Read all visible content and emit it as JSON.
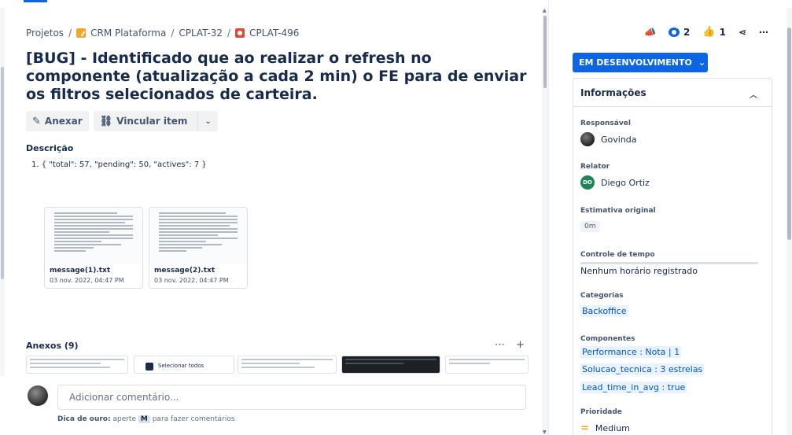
{
  "breadcrumb": {
    "root": "Projetos",
    "project": "CRM Plataforma",
    "parent": "CPLAT-32",
    "issue": "CPLAT-496",
    "separator": "/"
  },
  "issue": {
    "title": "[BUG] - Identificado que ao realizar o refresh no componente (atualização a cada 2 min) o FE para de enviar os filtros selecionados de carteira."
  },
  "actions": {
    "attach_label": "Anexar",
    "link_label": "Vincular item"
  },
  "description": {
    "heading": "Descrição",
    "line": "1. { \"total\": 57, \"pending\": 50, \"actives\": 7 }"
  },
  "files": [
    {
      "name": "message(1).txt",
      "date": "03 nov. 2022, 04:47 PM"
    },
    {
      "name": "message(2).txt",
      "date": "03 nov. 2022, 04:47 PM"
    }
  ],
  "attachments": {
    "heading": "Anexos (9)",
    "more_icon": "ellipsis-icon",
    "add_icon": "plus-icon",
    "strip_labels": [
      "Selecionar todos"
    ]
  },
  "comment": {
    "placeholder": "Adicionar comentário...",
    "tip_prefix": "Dica de ouro:",
    "tip_before": "aperte",
    "tip_key": "M",
    "tip_after": "para fazer comentários"
  },
  "side": {
    "watchers": "2",
    "votes": "1",
    "status": "EM DESENVOLVIMENTO",
    "info_title": "Informações",
    "fields": {
      "assignee_label": "Responsável",
      "assignee": "Govinda",
      "reporter_label": "Relator",
      "reporter": "Diego Ortiz",
      "reporter_initials": "DO",
      "estimate_label": "Estimativa original",
      "estimate": "0m",
      "time_label": "Controle de tempo",
      "time_value": "Nenhum horário registrado",
      "categories_label": "Categorias",
      "category": "Backoffice",
      "components_label": "Componentes",
      "components": [
        "Performance : Nota | 1",
        "Solucao_tecnica : 3 estrelas",
        "Lead_time_in_avg : true"
      ],
      "priority_label": "Prioridade",
      "priority": "Medium"
    }
  },
  "colors": {
    "primary": "#0c66e4",
    "bug": "#e34935",
    "project": "#f5a623",
    "reporter_avatar": "#1f845a"
  }
}
